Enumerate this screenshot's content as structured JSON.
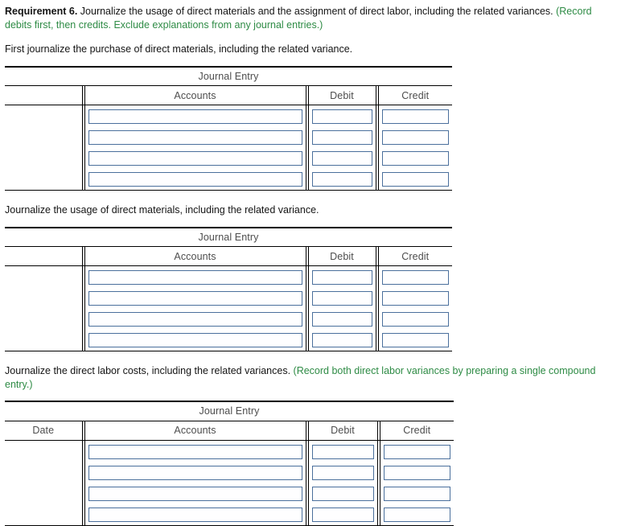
{
  "requirement": {
    "label": "Requirement 6.",
    "text": " Journalize the usage of direct materials and the assignment of direct labor, including the related variances. ",
    "hint": "(Record debits first, then credits. Exclude explanations from any journal entries.)"
  },
  "sections": [
    {
      "instruction": "First journalize the purchase of direct materials, including the related variance.",
      "hint": "",
      "table": {
        "title": "Journal Entry",
        "columns": {
          "date": "",
          "accounts": "Accounts",
          "debit": "Debit",
          "credit": "Credit"
        },
        "row_count": 4,
        "rows": [
          {
            "date": "",
            "accounts": "",
            "debit": "",
            "credit": ""
          },
          {
            "date": "",
            "accounts": "",
            "debit": "",
            "credit": ""
          },
          {
            "date": "",
            "accounts": "",
            "debit": "",
            "credit": ""
          },
          {
            "date": "",
            "accounts": "",
            "debit": "",
            "credit": ""
          }
        ]
      }
    },
    {
      "instruction": "Journalize the usage of direct materials, including the related variance.",
      "hint": "",
      "table": {
        "title": "Journal Entry",
        "columns": {
          "date": "",
          "accounts": "Accounts",
          "debit": "Debit",
          "credit": "Credit"
        },
        "row_count": 4,
        "rows": [
          {
            "date": "",
            "accounts": "",
            "debit": "",
            "credit": ""
          },
          {
            "date": "",
            "accounts": "",
            "debit": "",
            "credit": ""
          },
          {
            "date": "",
            "accounts": "",
            "debit": "",
            "credit": ""
          },
          {
            "date": "",
            "accounts": "",
            "debit": "",
            "credit": ""
          }
        ]
      }
    },
    {
      "instruction": "Journalize the direct labor costs, including the related variances.  ",
      "hint": "(Record both direct labor variances by preparing a single compound entry.)",
      "table": {
        "title": "Journal Entry",
        "columns": {
          "date": "Date",
          "accounts": "Accounts",
          "debit": "Debit",
          "credit": "Credit"
        },
        "row_count": 4,
        "rows": [
          {
            "date": "",
            "accounts": "",
            "debit": "",
            "credit": ""
          },
          {
            "date": "",
            "accounts": "",
            "debit": "",
            "credit": ""
          },
          {
            "date": "",
            "accounts": "",
            "debit": "",
            "credit": ""
          },
          {
            "date": "",
            "accounts": "",
            "debit": "",
            "credit": ""
          }
        ]
      }
    }
  ],
  "colors": {
    "hint_green": "#2e8b45",
    "input_border": "#4a6f9c",
    "header_text": "#4d4d4d",
    "rule": "#000000"
  }
}
